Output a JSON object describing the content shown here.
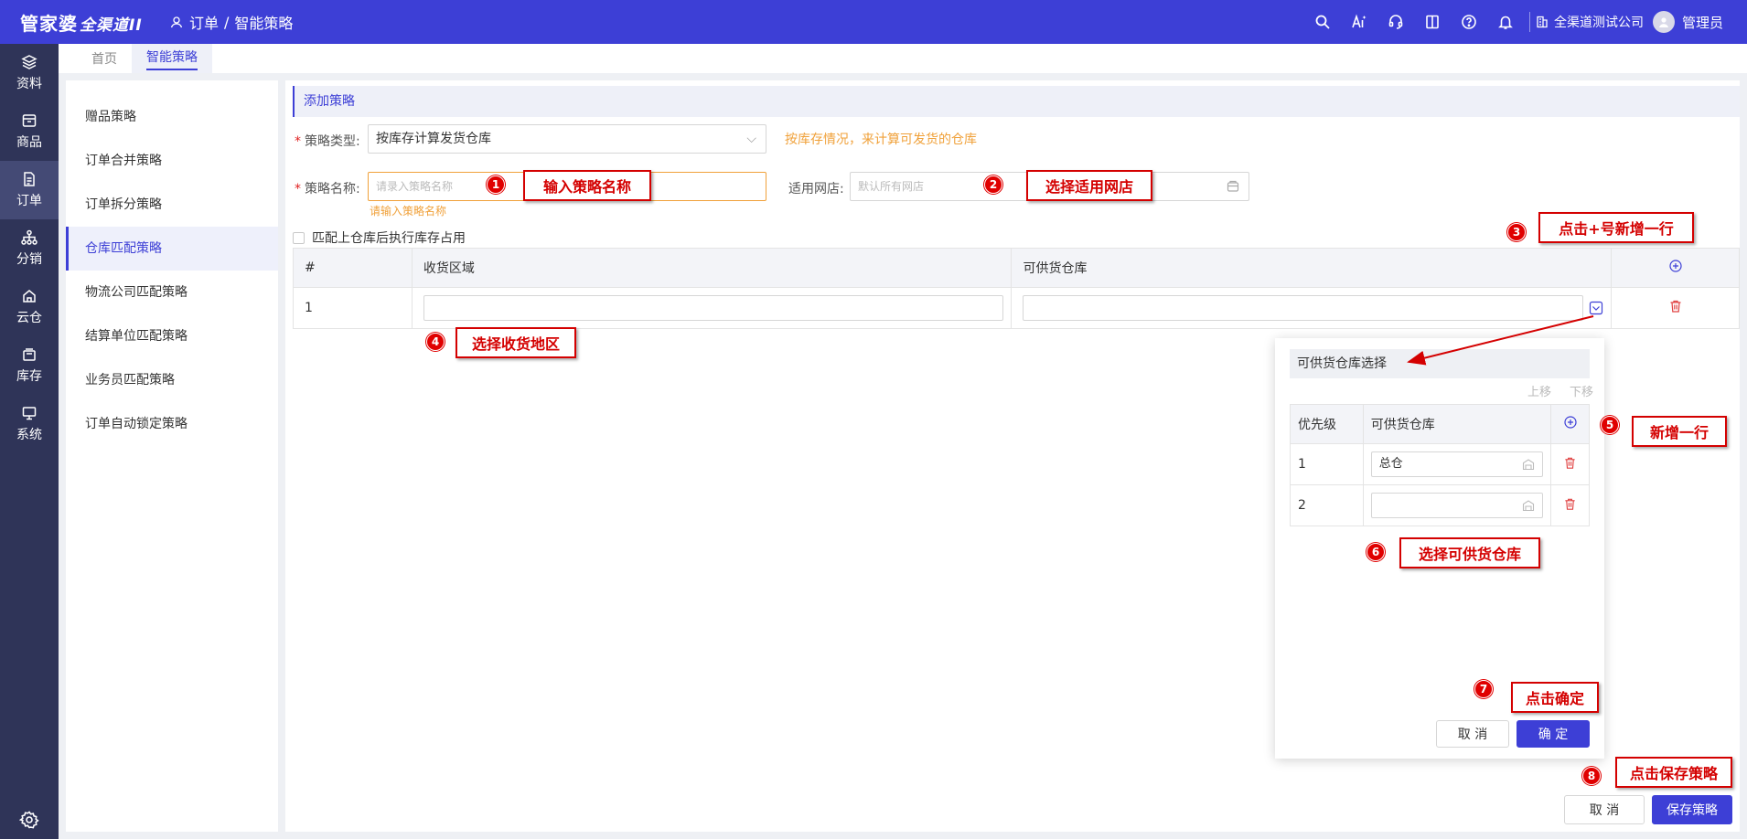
{
  "topbar": {
    "logo": "管家婆",
    "product": "全渠道II",
    "breadcrumb": [
      "订单",
      "/",
      "智能策略"
    ],
    "company": "全渠道测试公司",
    "user": "管理员"
  },
  "leftnav": [
    {
      "label": "资料",
      "icon": "layers-icon"
    },
    {
      "label": "商品",
      "icon": "box-icon"
    },
    {
      "label": "订单",
      "icon": "document-icon",
      "active": true
    },
    {
      "label": "分销",
      "icon": "network-icon"
    },
    {
      "label": "云仓",
      "icon": "cloud-house-icon"
    },
    {
      "label": "库存",
      "icon": "stack-icon"
    },
    {
      "label": "系统",
      "icon": "monitor-icon"
    }
  ],
  "tabs": [
    {
      "label": "首页"
    },
    {
      "label": "智能策略",
      "active": true
    }
  ],
  "strategies": [
    {
      "label": "赠品策略"
    },
    {
      "label": "订单合并策略"
    },
    {
      "label": "订单拆分策略"
    },
    {
      "label": "仓库匹配策略",
      "active": true
    },
    {
      "label": "物流公司匹配策略"
    },
    {
      "label": "结算单位匹配策略"
    },
    {
      "label": "业务员匹配策略"
    },
    {
      "label": "订单自动锁定策略"
    }
  ],
  "form": {
    "section_title": "添加策略",
    "type_label": "策略类型:",
    "type_value": "按库存计算发货仓库",
    "type_hint": "按库存情况，来计算可发货的仓库",
    "name_label": "策略名称:",
    "name_placeholder": "请录入策略名称",
    "name_error": "请输入策略名称",
    "shop_label": "适用网店:",
    "shop_placeholder": "默认所有网店",
    "checkbox_label": "匹配上仓库后执行库存占用",
    "table_headers": [
      "#",
      "收货区域",
      "可供货仓库"
    ],
    "table_rows": [
      {
        "index": "1"
      }
    ]
  },
  "popup": {
    "title": "可供货仓库选择",
    "move_up": "上移",
    "move_down": "下移",
    "headers": [
      "优先级",
      "可供货仓库"
    ],
    "rows": [
      {
        "priority": "1",
        "warehouse": "总仓"
      },
      {
        "priority": "2",
        "warehouse": ""
      }
    ],
    "cancel": "取 消",
    "confirm": "确 定"
  },
  "footer": {
    "cancel": "取 消",
    "save": "保存策略"
  },
  "annotations": [
    {
      "num": "1",
      "text": "输入策略名称"
    },
    {
      "num": "2",
      "text": "选择适用网店"
    },
    {
      "num": "3",
      "text": "点击+号新增一行"
    },
    {
      "num": "4",
      "text": "选择收货地区"
    },
    {
      "num": "5",
      "text": "新增一行"
    },
    {
      "num": "6",
      "text": "选择可供货仓库"
    },
    {
      "num": "7",
      "text": "点击确定"
    },
    {
      "num": "8",
      "text": "点击保存策略"
    }
  ],
  "colors": {
    "brand": "#3d3fd6",
    "nav": "#2f3458",
    "warning": "#f0a13a",
    "danger": "#e02020",
    "annotation": "#d40000"
  }
}
